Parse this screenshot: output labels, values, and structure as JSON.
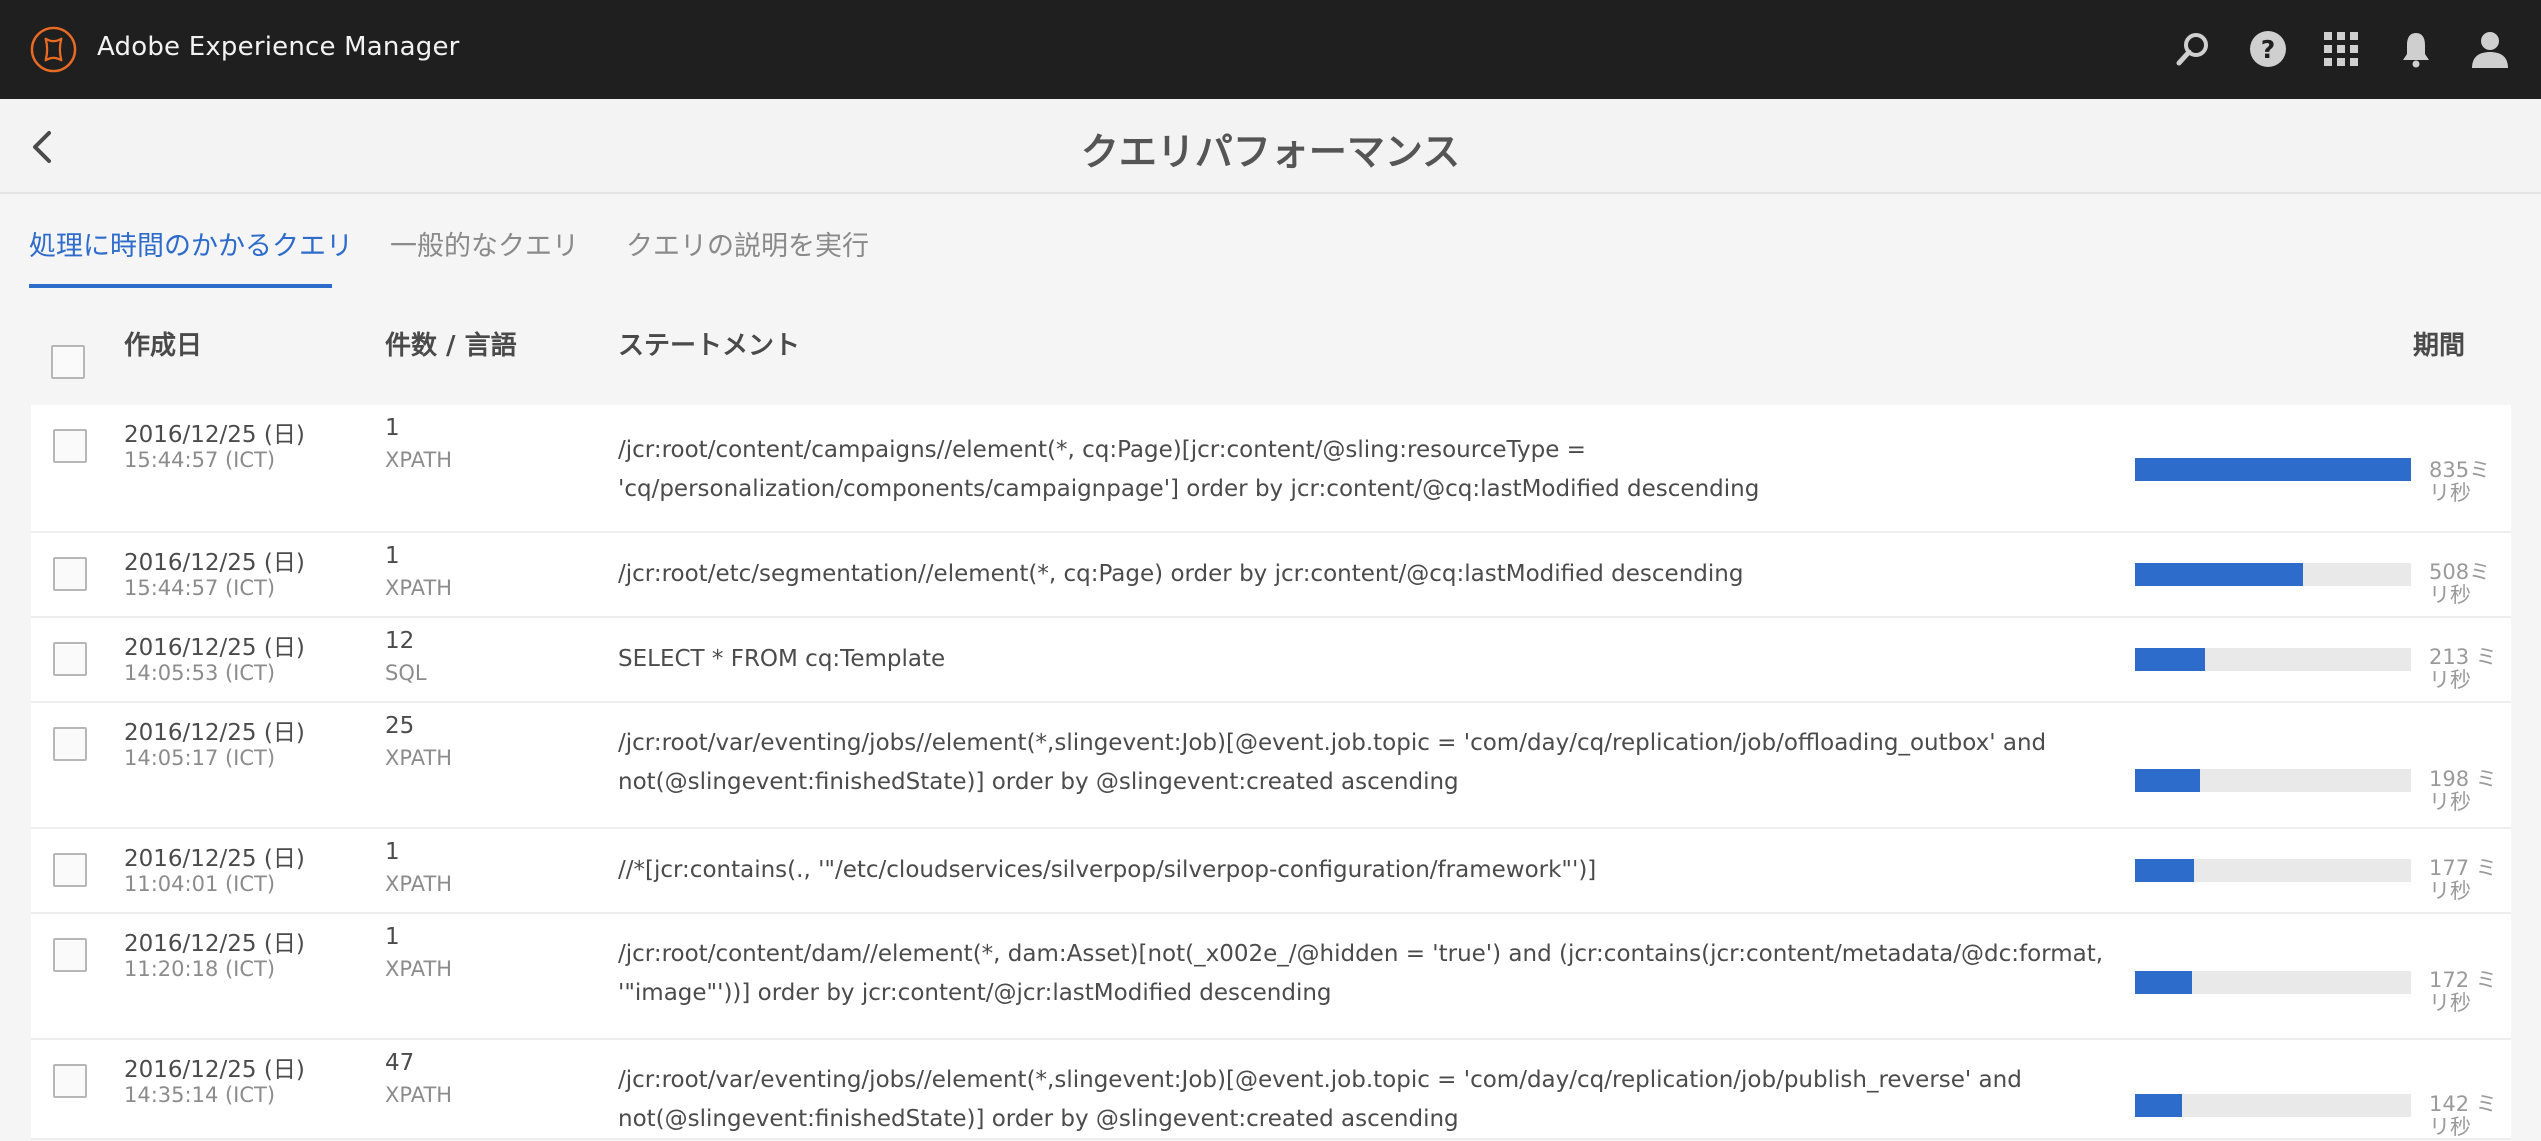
{
  "shell": {
    "brand": "Adobe Experience Manager",
    "icons": [
      "search-icon",
      "help-icon",
      "apps-grid-icon",
      "bell-icon",
      "user-icon"
    ],
    "bg_color": "#1f1f1f",
    "logo_color": "#e86a23"
  },
  "titlebar": {
    "title": "クエリパフォーマンス"
  },
  "tabs": [
    {
      "label": "処理に時間のかかるクエリ",
      "active": true
    },
    {
      "label": "一般的なクエリ",
      "active": false
    },
    {
      "label": "クエリの説明を実行",
      "active": false
    }
  ],
  "table": {
    "headers": {
      "date": "作成日",
      "count_lang": "件数 / 言語",
      "statement": "ステートメント",
      "duration": "期間"
    },
    "accent_color": "#2e6ccc",
    "rows": [
      {
        "date": "2016/12/25 (日)",
        "time": "15:44:57 (ICT)",
        "count": "1",
        "lang": "XPATH",
        "statement": "/jcr:root/content/campaigns//element(*, cq:Page)[jcr:content/@sling:resourceType = 'cq/personalization/components/campaignpage'] order by jcr:content/@cq:lastModified descending",
        "duration_label": "835ミリ秒",
        "duration_ms": 835
      },
      {
        "date": "2016/12/25 (日)",
        "time": "15:44:57 (ICT)",
        "count": "1",
        "lang": "XPATH",
        "statement": "/jcr:root/etc/segmentation//element(*, cq:Page) order by jcr:content/@cq:lastModified descending",
        "duration_label": "508ミリ秒",
        "duration_ms": 508
      },
      {
        "date": "2016/12/25 (日)",
        "time": "14:05:53 (ICT)",
        "count": "12",
        "lang": "SQL",
        "statement": "SELECT * FROM cq:Template",
        "duration_label": "213 ミリ秒",
        "duration_ms": 213
      },
      {
        "date": "2016/12/25 (日)",
        "time": "14:05:17 (ICT)",
        "count": "25",
        "lang": "XPATH",
        "statement": "/jcr:root/var/eventing/jobs//element(*,slingevent:Job)[@event.job.topic = 'com/day/cq/replication/job/offloading_outbox' and not(@slingevent:finishedState)] order by @slingevent:created ascending",
        "duration_label": "198 ミリ秒",
        "duration_ms": 198
      },
      {
        "date": "2016/12/25 (日)",
        "time": "11:04:01 (ICT)",
        "count": "1",
        "lang": "XPATH",
        "statement": "//*[jcr:contains(., '\"/etc/cloudservices/silverpop/silverpop-configuration/framework\"')]",
        "duration_label": "177 ミリ秒",
        "duration_ms": 177
      },
      {
        "date": "2016/12/25 (日)",
        "time": "11:20:18 (ICT)",
        "count": "1",
        "lang": "XPATH",
        "statement": "/jcr:root/content/dam//element(*, dam:Asset)[not(_x002e_/@hidden = 'true') and (jcr:contains(jcr:content/metadata/@dc:format, '\"image\"'))] order by jcr:content/@jcr:lastModified descending",
        "duration_label": "172 ミリ秒",
        "duration_ms": 172
      },
      {
        "date": "2016/12/25 (日)",
        "time": "14:35:14 (ICT)",
        "count": "47",
        "lang": "XPATH",
        "statement": "/jcr:root/var/eventing/jobs//element(*,slingevent:Job)[@event.job.topic = 'com/day/cq/replication/job/publish_reverse' and not(@slingevent:finishedState)] order by @slingevent:created ascending",
        "duration_label": "142 ミリ秒",
        "duration_ms": 142
      }
    ]
  }
}
